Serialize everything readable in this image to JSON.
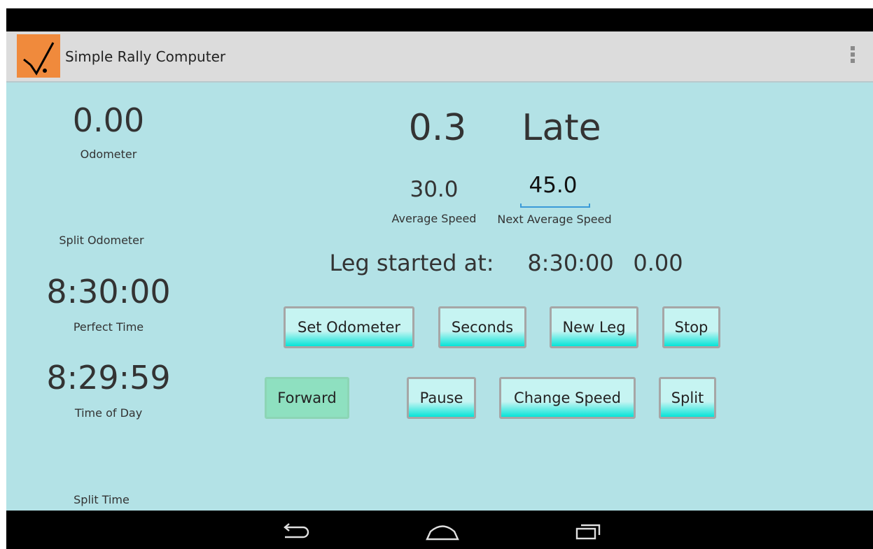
{
  "app": {
    "title": "Simple Rally Computer",
    "icon": "checkmark-icon",
    "accent": "#f08a3c",
    "background": "#b3e2e6"
  },
  "left_panel": {
    "odometer_value": "0.00",
    "odometer_label": "Odometer",
    "split_odometer_label": "Split Odometer",
    "perfect_time_value": "8:30:00",
    "perfect_time_label": "Perfect Time",
    "time_of_day_value": "8:29:59",
    "time_of_day_label": "Time of Day",
    "split_time_label": "Split Time"
  },
  "status": {
    "offset": "0.3",
    "state": "Late"
  },
  "speeds": {
    "average_value": "30.0",
    "average_label": "Average Speed",
    "next_value": "45.0",
    "next_label": "Next Average Speed"
  },
  "leg": {
    "label": "Leg started at:",
    "time": "8:30:00",
    "odometer": "0.00"
  },
  "buttons": {
    "set_odometer": "Set Odometer",
    "seconds": "Seconds",
    "new_leg": "New Leg",
    "stop": "Stop",
    "forward": "Forward",
    "pause": "Pause",
    "change_speed": "Change Speed",
    "split": "Split"
  },
  "nav": {
    "back": "back-icon",
    "home": "home-icon",
    "recents": "recents-icon"
  }
}
